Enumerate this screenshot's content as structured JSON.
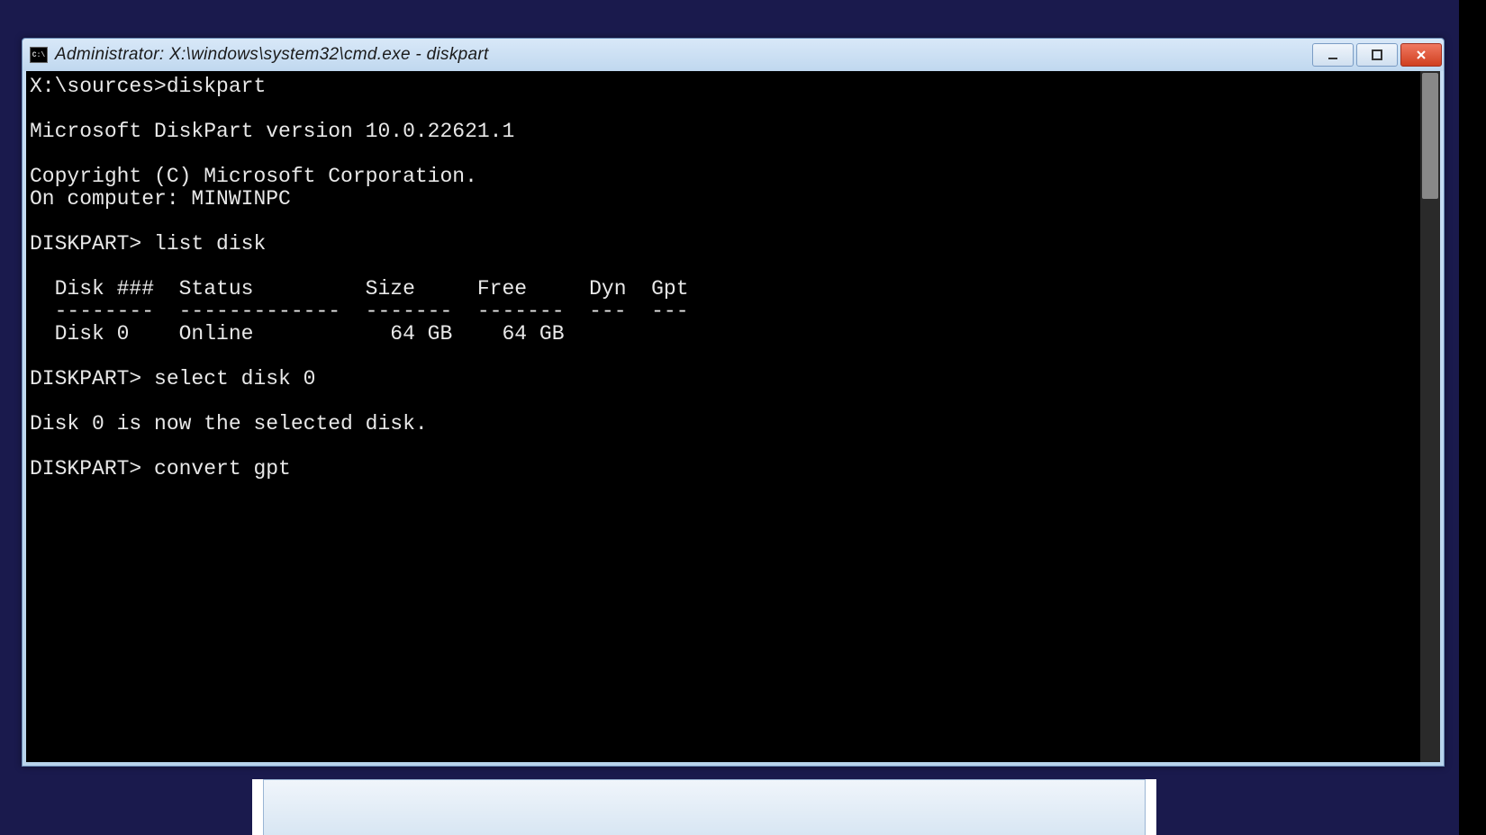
{
  "window": {
    "title": "Administrator: X:\\windows\\system32\\cmd.exe - diskpart"
  },
  "console": {
    "lines": [
      "X:\\sources>diskpart",
      "",
      "Microsoft DiskPart version 10.0.22621.1",
      "",
      "Copyright (C) Microsoft Corporation.",
      "On computer: MINWINPC",
      "",
      "DISKPART> list disk",
      "",
      "  Disk ###  Status         Size     Free     Dyn  Gpt",
      "  --------  -------------  -------  -------  ---  ---",
      "  Disk 0    Online           64 GB    64 GB",
      "",
      "DISKPART> select disk 0",
      "",
      "Disk 0 is now the selected disk.",
      "",
      "DISKPART> convert gpt"
    ]
  }
}
